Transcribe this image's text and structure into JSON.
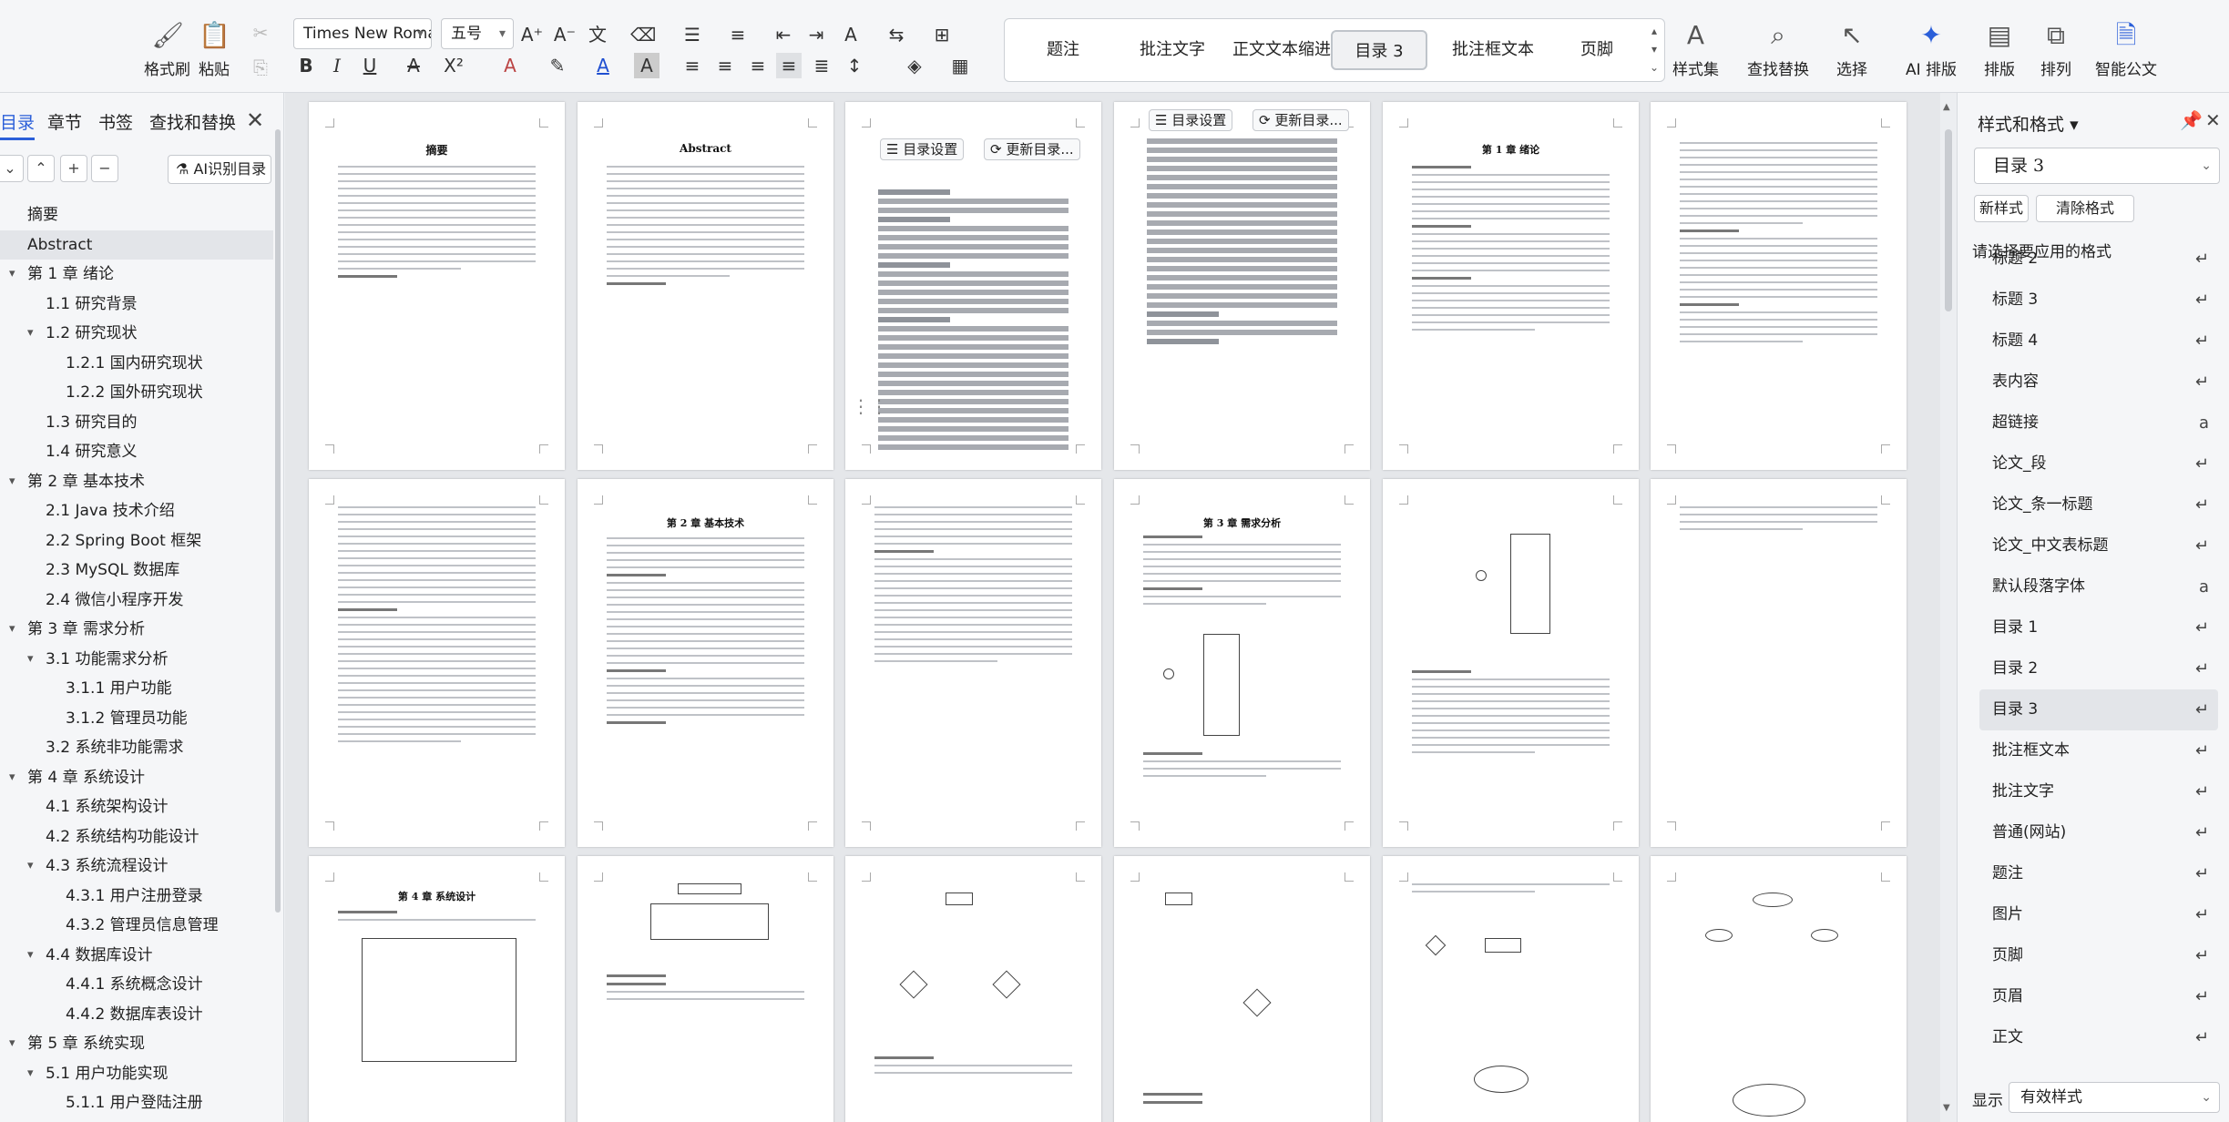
{
  "ribbon": {
    "format_painter": "格式刷",
    "paste": "粘贴",
    "font_name": "Times New Roma",
    "font_size": "五号",
    "style_gallery": [
      "题注",
      "批注文字",
      "正文文本缩进",
      "目录 3",
      "批注框文本",
      "页脚"
    ],
    "style_set": "样式集",
    "find_replace": "查找替换",
    "select": "选择",
    "ai_layout": "AI 排版",
    "typeset": "排版",
    "arrange": "排列",
    "smart_doc": "智能公文"
  },
  "nav": {
    "tabs": [
      "目录",
      "章节",
      "书签",
      "查找和替换"
    ],
    "ai_toc": "AI识别目录",
    "items": [
      {
        "text": "摘要",
        "level": 0,
        "toggle": ""
      },
      {
        "text": "Abstract",
        "level": 0,
        "toggle": "",
        "selected": true
      },
      {
        "text": "第 1 章  绪论",
        "level": 0,
        "toggle": "▾"
      },
      {
        "text": "1.1  研究背景",
        "level": 1,
        "toggle": ""
      },
      {
        "text": "1.2  研究现状",
        "level": 1,
        "toggle": "▾"
      },
      {
        "text": "1.2.1  国内研究现状",
        "level": 2,
        "toggle": ""
      },
      {
        "text": "1.2.2  国外研究现状",
        "level": 2,
        "toggle": ""
      },
      {
        "text": "1.3  研究目的",
        "level": 1,
        "toggle": ""
      },
      {
        "text": "1.4  研究意义",
        "level": 1,
        "toggle": ""
      },
      {
        "text": "第 2 章  基本技术",
        "level": 0,
        "toggle": "▾"
      },
      {
        "text": "2.1 Java 技术介绍",
        "level": 1,
        "toggle": ""
      },
      {
        "text": "2.2 Spring Boot 框架",
        "level": 1,
        "toggle": ""
      },
      {
        "text": "2.3 MySQL 数据库",
        "level": 1,
        "toggle": ""
      },
      {
        "text": "2.4 微信小程序开发",
        "level": 1,
        "toggle": ""
      },
      {
        "text": "第 3 章  需求分析",
        "level": 0,
        "toggle": "▾"
      },
      {
        "text": "3.1  功能需求分析",
        "level": 1,
        "toggle": "▾"
      },
      {
        "text": "3.1.1  用户功能",
        "level": 2,
        "toggle": ""
      },
      {
        "text": "3.1.2  管理员功能",
        "level": 2,
        "toggle": ""
      },
      {
        "text": "3.2  系统非功能需求",
        "level": 1,
        "toggle": ""
      },
      {
        "text": "第 4 章  系统设计",
        "level": 0,
        "toggle": "▾"
      },
      {
        "text": "4.1  系统架构设计",
        "level": 1,
        "toggle": ""
      },
      {
        "text": "4.2  系统结构功能设计",
        "level": 1,
        "toggle": ""
      },
      {
        "text": "4.3  系统流程设计",
        "level": 1,
        "toggle": "▾"
      },
      {
        "text": "4.3.1  用户注册登录",
        "level": 2,
        "toggle": ""
      },
      {
        "text": "4.3.2 管理员信息管理",
        "level": 2,
        "toggle": ""
      },
      {
        "text": "4.4 数据库设计",
        "level": 1,
        "toggle": "▾"
      },
      {
        "text": "4.4.1  系统概念设计",
        "level": 2,
        "toggle": ""
      },
      {
        "text": "4.4.2  数据库表设计",
        "level": 2,
        "toggle": ""
      },
      {
        "text": "第 5 章  系统实现",
        "level": 0,
        "toggle": "▾"
      },
      {
        "text": "5.1  用户功能实现",
        "level": 1,
        "toggle": "▾"
      },
      {
        "text": "5.1.1  用户登陆注册",
        "level": 2,
        "toggle": ""
      }
    ]
  },
  "doc": {
    "abstract_cn_title": "摘要",
    "abstract_en_title": "Abstract",
    "toc_settings": "目录设置",
    "update_toc": "更新目录...",
    "ch1_title": "第 1 章  绪论",
    "ch2_title": "第 2 章  基本技术",
    "ch3_title": "第 3 章  需求分析",
    "ch4_title": "第 4 章  系统设计"
  },
  "rightpane": {
    "title": "样式和格式",
    "current_style": "目录 3",
    "new_style": "新样式",
    "clear_format": "清除格式",
    "hint": "请选择要应用的格式",
    "styles": [
      {
        "name": "标题 2",
        "mark": "↵"
      },
      {
        "name": "标题 3",
        "mark": "↵"
      },
      {
        "name": "标题 4",
        "mark": "↵"
      },
      {
        "name": "表内容",
        "mark": "↵"
      },
      {
        "name": "超链接",
        "mark": "a"
      },
      {
        "name": "论文_段",
        "mark": "↵"
      },
      {
        "name": "论文_条一标题",
        "mark": "↵"
      },
      {
        "name": "论文_中文表标题",
        "mark": "↵"
      },
      {
        "name": "默认段落字体",
        "mark": "a"
      },
      {
        "name": "目录 1",
        "mark": "↵"
      },
      {
        "name": "目录 2",
        "mark": "↵"
      },
      {
        "name": "目录 3",
        "mark": "↵",
        "selected": true
      },
      {
        "name": "批注框文本",
        "mark": "↵"
      },
      {
        "name": "批注文字",
        "mark": "↵"
      },
      {
        "name": "普通(网站)",
        "mark": "↵"
      },
      {
        "name": "题注",
        "mark": "↵"
      },
      {
        "name": "图片",
        "mark": "↵"
      },
      {
        "name": "页脚",
        "mark": "↵"
      },
      {
        "name": "页眉",
        "mark": "↵"
      },
      {
        "name": "正文",
        "mark": "↵"
      }
    ],
    "show_label": "显示",
    "filter": "有效样式"
  }
}
